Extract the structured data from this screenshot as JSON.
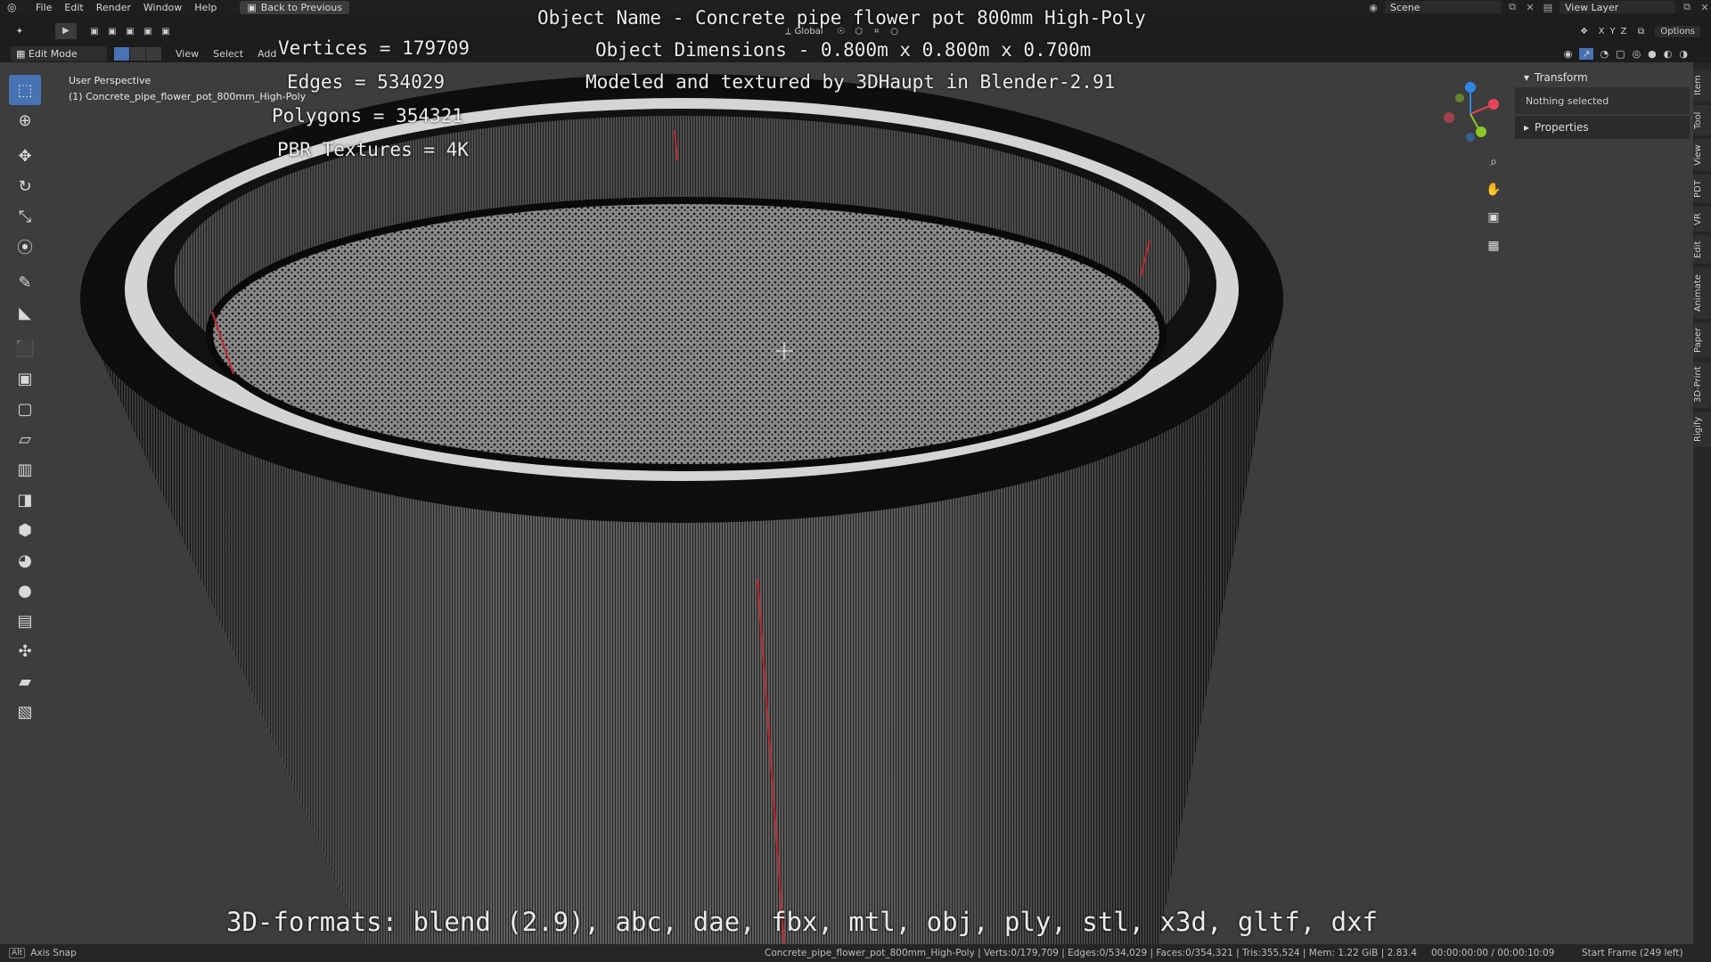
{
  "topbar": {
    "menus": [
      "File",
      "Edit",
      "Render",
      "Window",
      "Help"
    ],
    "back_label": "Back to Previous",
    "scene": "Scene",
    "view_layer": "View Layer"
  },
  "header": {
    "transform_orientation": "Global",
    "axes": [
      "X",
      "Y",
      "Z"
    ],
    "options_label": "Options"
  },
  "viewport_header": {
    "mode": "Edit Mode",
    "menus": [
      "View",
      "Select",
      "Add"
    ]
  },
  "viewport": {
    "perspective_label": "User Perspective",
    "object_label": "(1) Concrete_pipe_flower_pot_800mm_High-Poly"
  },
  "overlay": {
    "object_name": "Object Name - Concrete pipe flower pot 800mm High-Poly",
    "dimensions": "Object Dimensions -  0.800m x 0.800m x 0.700m",
    "credit": "Modeled and textured by 3DHaupt in Blender-2.91",
    "vertices": "Vertices = 179709",
    "edges": "Edges = 534029",
    "polygons": "Polygons = 354321",
    "textures": "PBR Textures = 4K",
    "formats": "3D-formats: blend (2.9), abc, dae, fbx, mtl, obj, ply, stl, x3d, gltf, dxf"
  },
  "sidebar": {
    "transform_title": "Transform",
    "transform_body": "Nothing selected",
    "properties_title": "Properties",
    "tabs": [
      "Item",
      "Tool",
      "View",
      "PDT",
      "VR",
      "Edit",
      "Animate",
      "Paper",
      "3D-Print",
      "Rigify"
    ]
  },
  "statusbar": {
    "key": "Alt",
    "snap_label": "Axis Snap",
    "scene_info": "Concrete_pipe_flower_pot_800mm_High-Poly | Verts:0/179,709 | Edges:0/534,029 | Faces:0/354,321 | Tris:355,524 | Mem: 1.22 GiB | 2.83.4",
    "time": "00:00:00:00 / 00:00:10:09",
    "frame": "Start Frame (249 left)"
  },
  "colors": {
    "accent": "#4772b3",
    "viewport_bg": "#3d3d3d",
    "axis_x": "#e8435a",
    "axis_y": "#8ac926",
    "axis_z": "#2f86e8"
  },
  "icons": [
    "blender-logo-icon",
    "select-box-icon",
    "cursor-icon",
    "move-icon",
    "rotate-icon",
    "scale-icon",
    "transform-icon",
    "annotate-icon",
    "measure-icon",
    "add-cube-icon",
    "extrude-icon",
    "inset-icon",
    "bevel-icon",
    "loop-cut-icon",
    "knife-icon",
    "poly-build-icon",
    "spin-icon",
    "smooth-icon",
    "edge-slide-icon",
    "shrink-fatten-icon",
    "shear-icon",
    "rip-icon",
    "zoom-icon",
    "hand-icon",
    "camera-icon",
    "grid-icon"
  ]
}
